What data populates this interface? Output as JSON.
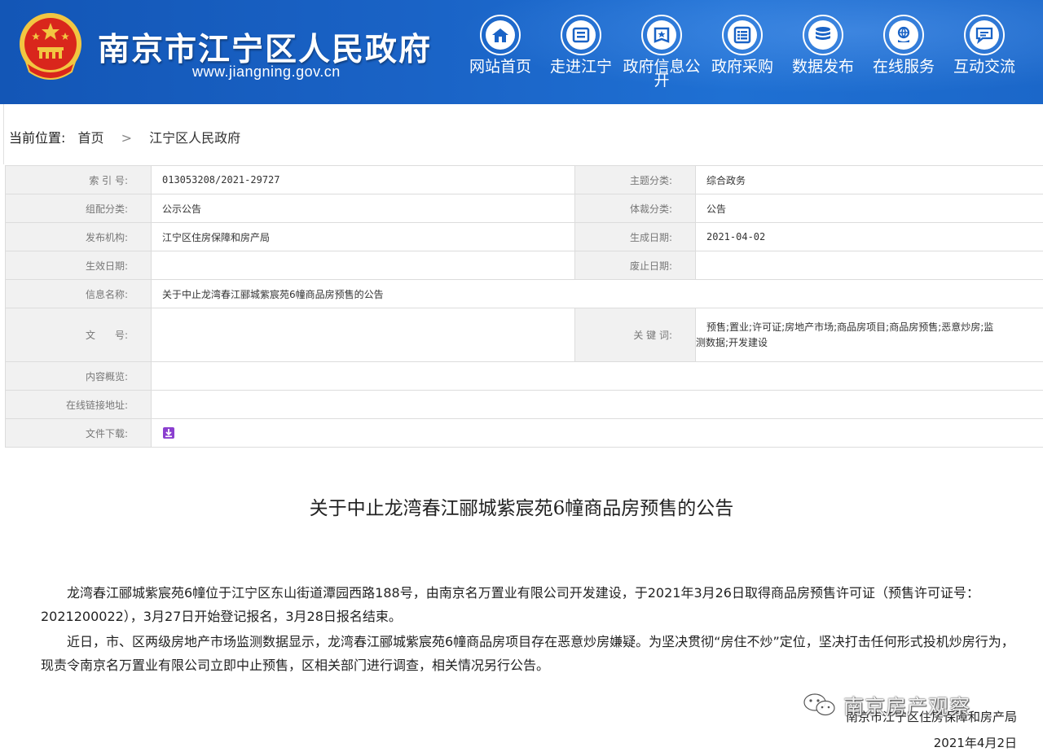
{
  "header": {
    "site_name": "南京市江宁区人民政府",
    "site_url": "www.jiangning.gov.cn",
    "colors": {
      "header_bg": "#1a63c6",
      "emblem_red": "#d9261c",
      "emblem_gold": "#f2c641"
    },
    "nav": [
      {
        "label": "网站首页",
        "icon": "home-icon"
      },
      {
        "label": "走进江宁",
        "icon": "book-icon"
      },
      {
        "label": "政府信息公开",
        "icon": "document-star-icon"
      },
      {
        "label": "政府采购",
        "icon": "list-icon"
      },
      {
        "label": "数据发布",
        "icon": "database-icon"
      },
      {
        "label": "在线服务",
        "icon": "globe-hand-icon"
      },
      {
        "label": "互动交流",
        "icon": "chat-icon"
      }
    ]
  },
  "breadcrumb": {
    "lead": "当前位置:",
    "items": [
      "首页",
      "江宁区人民政府"
    ],
    "separator": ">"
  },
  "info": {
    "index_label": "索 引 号:",
    "index_value": "013053208/2021-29727",
    "topic_label": "主题分类:",
    "topic_value": "综合政务",
    "group_label": "组配分类:",
    "group_value": "公示公告",
    "genre_label": "体裁分类:",
    "genre_value": "公告",
    "publisher_label": "发布机构:",
    "publisher_value": "江宁区住房保障和房产局",
    "created_label": "生成日期:",
    "created_value": "2021-04-02",
    "effective_label": "生效日期:",
    "effective_value": "",
    "expired_label": "废止日期:",
    "expired_value": "",
    "name_label": "信息名称:",
    "name_value": "关于中止龙湾春江郦城紫宸苑6幢商品房预售的公告",
    "docno_label": "文　　号:",
    "docno_value": "",
    "keywords_label": "关 键 词:",
    "keywords_line1": "预售;置业;许可证;房地产市场;商品房项目;商品房预售;恶意炒房;监",
    "keywords_line2": "测数据;开发建设",
    "summary_label": "内容概览:",
    "summary_value": "",
    "link_label": "在线链接地址:",
    "link_value": "",
    "download_label": "文件下载:",
    "download_icon": "download-icon"
  },
  "article": {
    "title": "关于中止龙湾春江郦城紫宸苑6幢商品房预售的公告",
    "p1": "龙湾春江郦城紫宸苑6幢位于江宁区东山街道潭园西路188号，由南京名万置业有限公司开发建设，于2021年3月26日取得商品房预售许可证（预售许可证号：2021200022），3月27日开始登记报名，3月28日报名结束。",
    "p2": "近日，市、区两级房地产市场监测数据显示，龙湾春江郦城紫宸苑6幢商品房项目存在恶意炒房嫌疑。为坚决贯彻“房住不炒”定位，坚决打击任何形式投机炒房行为，现责令南京名万置业有限公司立即中止预售，区相关部门进行调查，相关情况另行公告。",
    "signature": "南京市江宁区住房保障和房产局",
    "date": "2021年4月2日"
  },
  "watermark": {
    "text": "南京房产观察",
    "icon": "wechat-icon"
  }
}
